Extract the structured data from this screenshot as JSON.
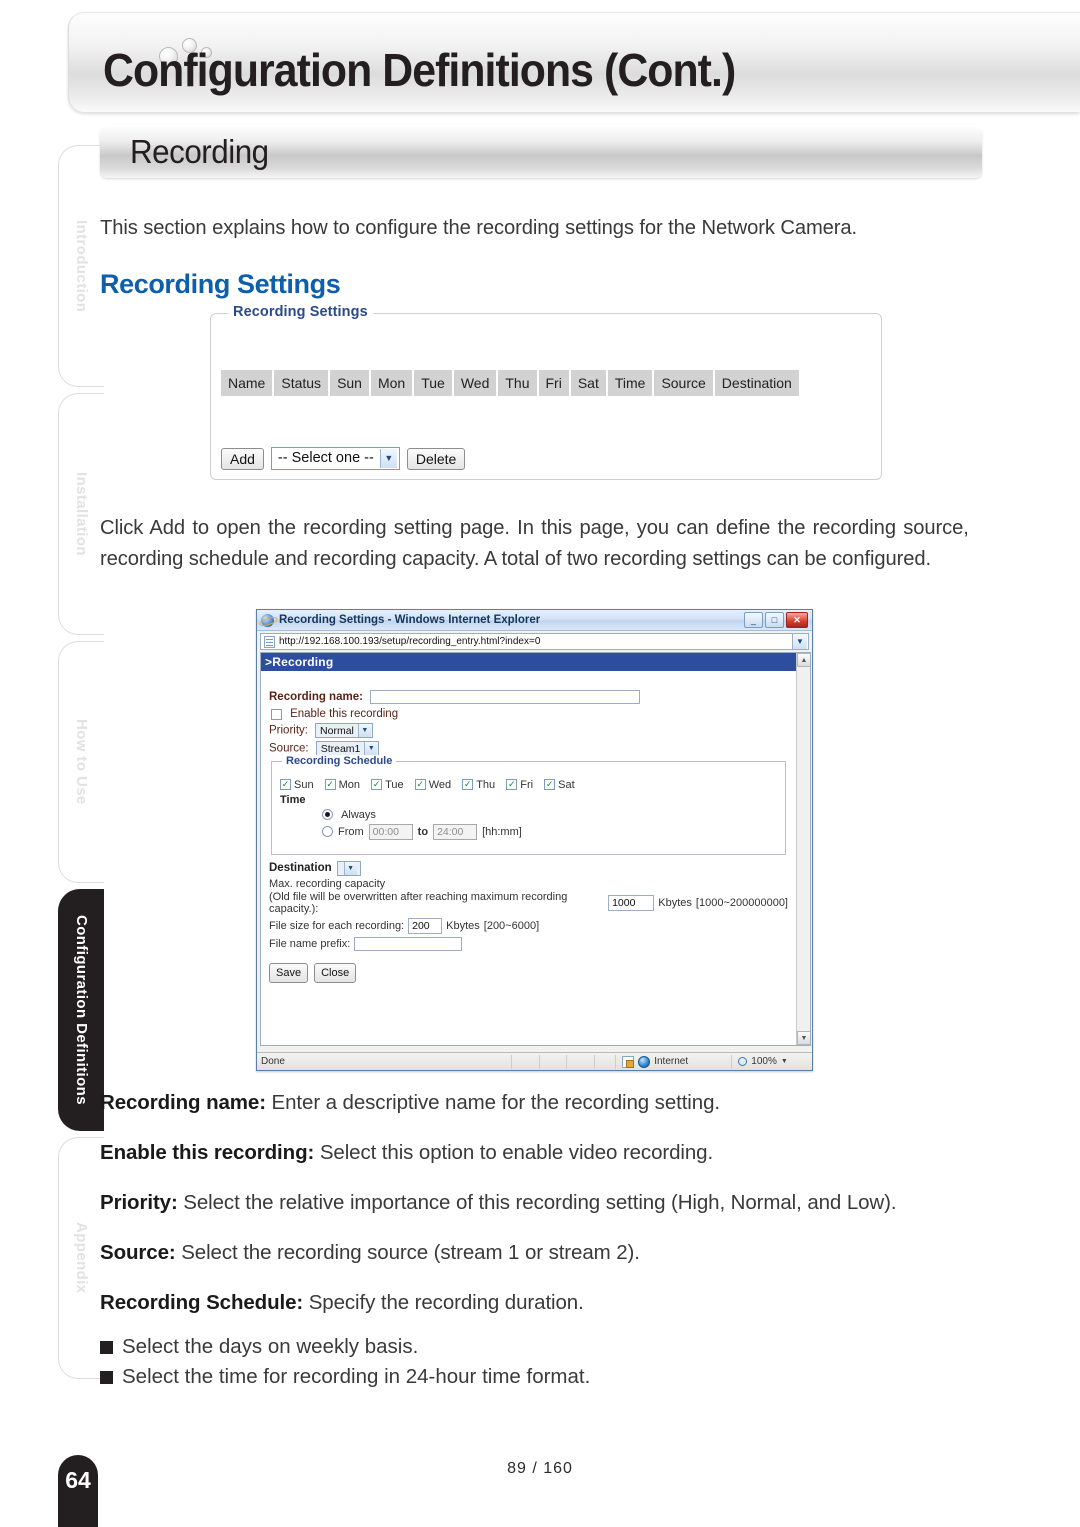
{
  "header": {
    "title": "Configuration Definitions (Cont.)"
  },
  "section": {
    "title": "Recording"
  },
  "sidebar": {
    "tabs": [
      {
        "label": "Introduction",
        "active": false
      },
      {
        "label": "Installation",
        "active": false
      },
      {
        "label": "How to Use",
        "active": false
      },
      {
        "label": "Configuration Definitions",
        "active": true
      },
      {
        "label": "Appendix",
        "active": false
      }
    ]
  },
  "main": {
    "intro_paragraph": "This section explains how to configure the recording settings for the Network Camera.",
    "subheading": "Recording Settings",
    "click_add_paragraph": "Click Add to open the recording setting page. In this page, you can define the recording source, recording schedule and recording capacity. A total of two recording settings can be configured.",
    "definitions": [
      {
        "term": "Recording name:",
        "desc": " Enter a descriptive name for the recording setting."
      },
      {
        "term": "Enable this recording:",
        "desc": " Select this option to enable video recording."
      },
      {
        "term": "Priority:",
        "desc": " Select the relative importance of this recording setting (High, Normal, and Low)."
      },
      {
        "term": "Source:",
        "desc": " Select the recording source (stream 1 or stream 2)."
      },
      {
        "term": "Recording Schedule:",
        "desc": " Specify the recording duration."
      }
    ],
    "bullets": [
      "Select the days on weekly basis.",
      "Select the time for recording in 24-hour time format."
    ]
  },
  "figure_settings_panel": {
    "legend": "Recording Settings",
    "columns": [
      "Name",
      "Status",
      "Sun",
      "Mon",
      "Tue",
      "Wed",
      "Thu",
      "Fri",
      "Sat",
      "Time",
      "Source",
      "Destination"
    ],
    "rows": [],
    "add_button": "Add",
    "select_value": "-- Select one --",
    "delete_button": "Delete"
  },
  "figure_browser": {
    "window_title": "Recording Settings - Windows Internet Explorer",
    "address_url": "http://192.168.100.193/setup/recording_entry.html?index=0",
    "page_banner": ">Recording",
    "recording_name_label": "Recording name:",
    "recording_name_value": "",
    "enable_checkbox_label": "Enable this recording",
    "enable_checked": false,
    "priority_label": "Priority:",
    "priority_value": "Normal",
    "source_label": "Source:",
    "source_value": "Stream1",
    "schedule_legend": "Recording Schedule",
    "days": [
      {
        "label": "Sun",
        "checked": true
      },
      {
        "label": "Mon",
        "checked": true
      },
      {
        "label": "Tue",
        "checked": true
      },
      {
        "label": "Wed",
        "checked": true
      },
      {
        "label": "Thu",
        "checked": true
      },
      {
        "label": "Fri",
        "checked": true
      },
      {
        "label": "Sat",
        "checked": true
      }
    ],
    "time_label": "Time",
    "always_label": "Always",
    "always_selected": true,
    "from_label": "From",
    "from_value": "00:00",
    "to_label": "to",
    "to_value": "24:00",
    "hhmm_hint": "[hh:mm]",
    "destination_label": "Destination",
    "destination_value": "",
    "max_capacity_label": "Max. recording capacity",
    "overwrite_note": "(Old file will be overwritten after reaching maximum recording capacity.):",
    "max_capacity_value": "1000",
    "max_capacity_unit": "Kbytes",
    "max_capacity_range": "[1000~200000000]",
    "file_size_label": "File size for each recording:",
    "file_size_value": "200",
    "file_size_unit": "Kbytes",
    "file_size_range": "[200~6000]",
    "file_prefix_label": "File name prefix:",
    "file_prefix_value": "",
    "save_button": "Save",
    "close_button": "Close",
    "status_text": "Done",
    "status_zone": "Internet",
    "status_zoom": "100%",
    "minimize_glyph": "_",
    "restore_glyph": "□",
    "close_glyph": "✕"
  },
  "footer": {
    "page_tab": "64",
    "page_counter": "89 / 160"
  },
  "colors": {
    "accent_blue": "#0d5fac",
    "banner_blue": "#2d4d9e",
    "panel_legend_blue": "#2b4a8b",
    "dark": "#231f20",
    "ie_label_brown": "#5a2418"
  }
}
